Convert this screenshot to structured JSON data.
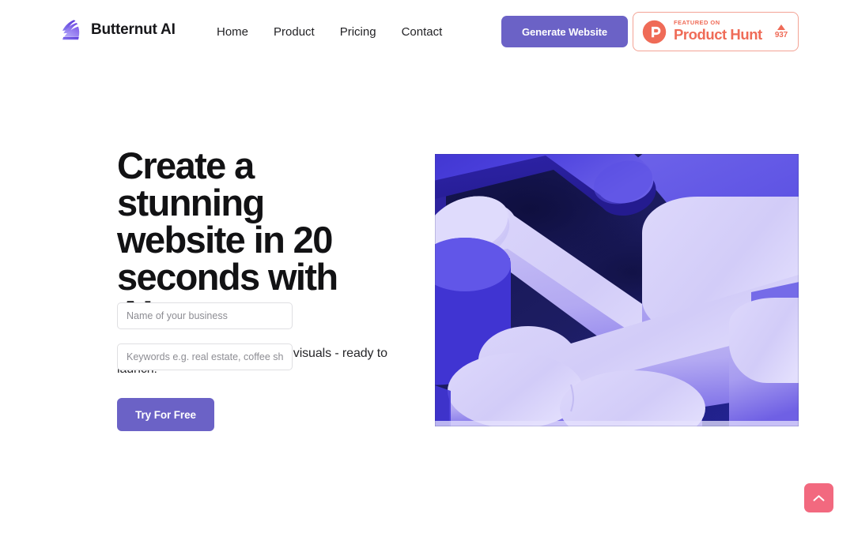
{
  "brand": {
    "name": "Butternut AI",
    "logo_icon": "butternut-swirl-logo"
  },
  "nav": {
    "items": [
      {
        "label": "Home"
      },
      {
        "label": "Product"
      },
      {
        "label": "Pricing"
      },
      {
        "label": "Contact"
      }
    ]
  },
  "header": {
    "generate_label": "Generate Website",
    "product_hunt": {
      "featured_label": "FEATURED ON",
      "name": "Product Hunt",
      "votes": "937",
      "logo_icon": "product-hunt-logo",
      "caret_icon": "caret-up-icon"
    }
  },
  "hero": {
    "headline": "Create a stunning website in 20 seconds with AI",
    "subhead": "Complete website with text and visuals - ready to launch!",
    "business_placeholder": "Name of your business",
    "business_value": "",
    "keywords_placeholder": "Keywords e.g. real estate, coffee sh",
    "keywords_value": "",
    "cta_label": "Try For Free",
    "image_alt": "3d-abstract-purple-capsule-bars"
  },
  "scroll_top": {
    "icon": "chevron-up-icon",
    "label": ""
  },
  "colors": {
    "accent_purple": "#6b62c6",
    "product_hunt_orange": "#ef6b57",
    "scroll_top_pink": "#f2697f",
    "text_dark": "#121214",
    "border_gray": "#dfdfe2",
    "hero_bg_navy": "#181852",
    "hero_light_lavender": "#d7d2f7",
    "hero_blue": "#4a3fd0"
  }
}
